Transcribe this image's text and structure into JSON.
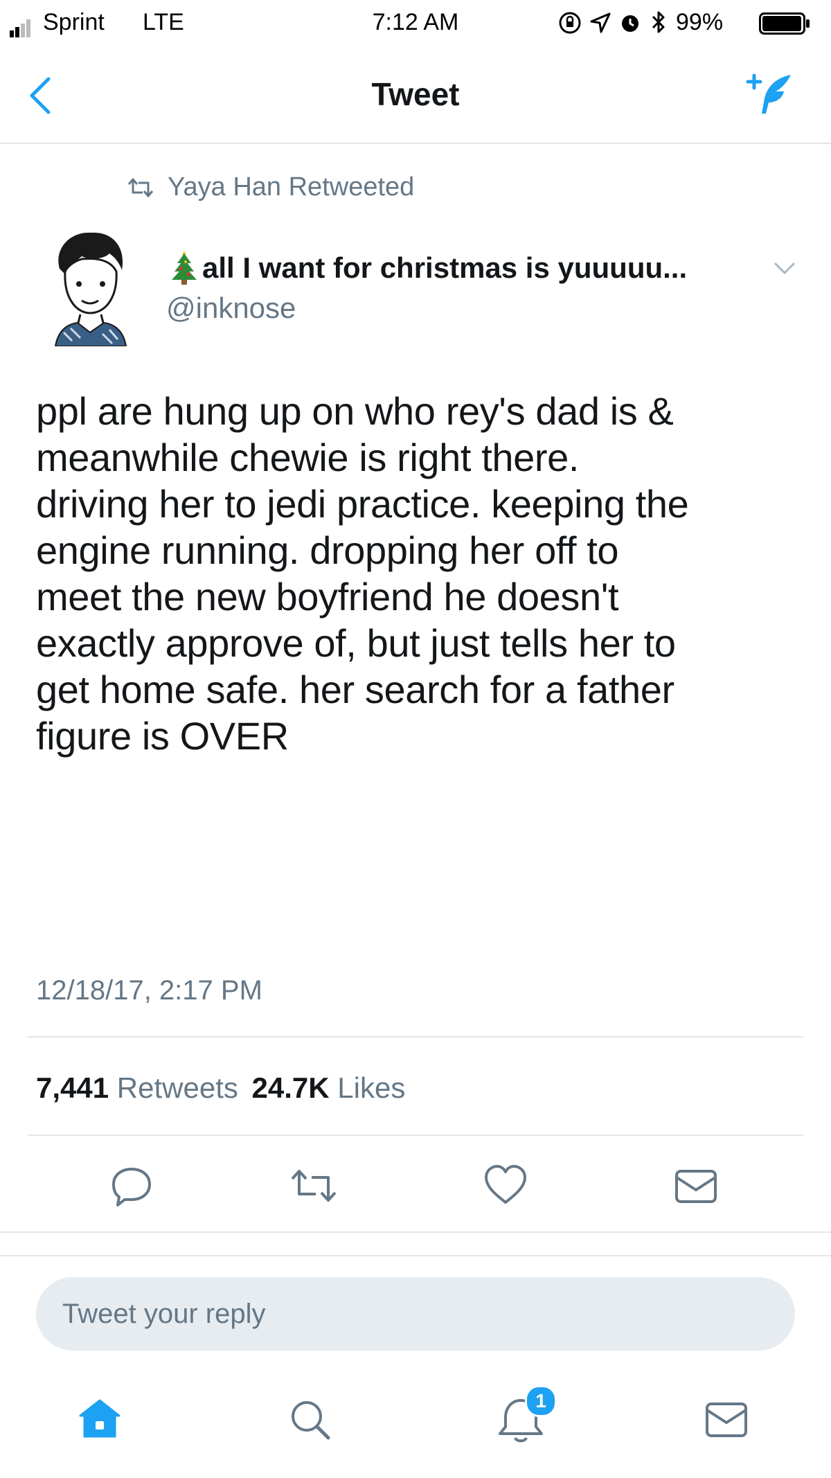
{
  "status_bar": {
    "carrier": "Sprint",
    "network": "LTE",
    "time": "7:12 AM",
    "battery_percent": "99%",
    "battery_level": 0.99
  },
  "nav": {
    "title": "Tweet"
  },
  "retweet_context": {
    "text": "Yaya Han Retweeted"
  },
  "author": {
    "display_name": "all I want for christmas is yuuuuu...",
    "handle": "@inknose",
    "name_emoji": "christmas-tree"
  },
  "tweet": {
    "text": "ppl are hung up on who rey's dad is &\nmeanwhile chewie is right there.\ndriving her to jedi practice. keeping the\nengine running. dropping her off to\nmeet the new boyfriend he doesn't\nexactly approve of, but just tells her to\nget home safe. her search for a father\nfigure is OVER",
    "timestamp": "12/18/17, 2:17 PM"
  },
  "stats": {
    "retweets_count": "7,441",
    "retweets_label": "Retweets",
    "likes_count": "24.7K",
    "likes_label": "Likes"
  },
  "actions": [
    "reply-icon",
    "retweet-icon",
    "like-icon",
    "direct-message-icon"
  ],
  "reply": {
    "placeholder": "Tweet your reply"
  },
  "tab_bar": {
    "tabs": [
      "home-icon",
      "search-icon",
      "notifications-icon",
      "messages-icon"
    ],
    "notifications_badge": "1"
  },
  "colors": {
    "accent": "#1da1f2",
    "text": "#14171a",
    "muted": "#657786",
    "divider": "#e1e8ed",
    "reply_bg": "#e6ecf0"
  }
}
